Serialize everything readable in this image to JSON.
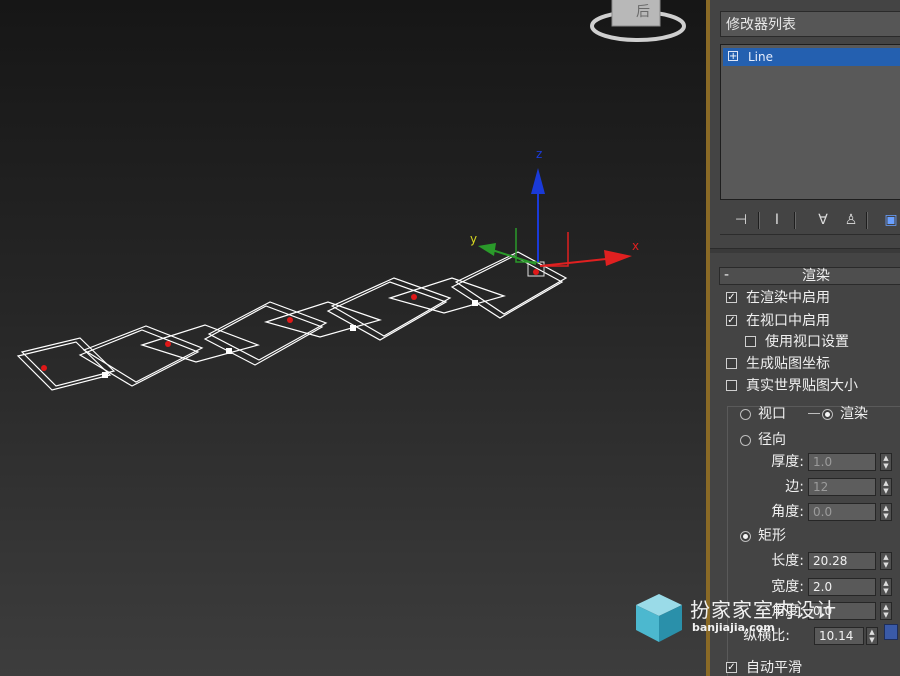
{
  "viewport": {
    "viewcube_face_label": "后",
    "axes": {
      "x_label": "x",
      "y_label": "y",
      "z_label": "z"
    }
  },
  "modifier_panel": {
    "modifier_list_label": "修改器列表",
    "stack_items": [
      {
        "label": "Line"
      }
    ],
    "toolbar_icons": [
      "pin-stack-icon",
      "show-end-result-icon",
      "make-unique-icon",
      "remove-modifier-icon",
      "configure-modifier-sets-icon"
    ]
  },
  "rendering_rollout": {
    "collapse_symbol": "-",
    "title": "渲染",
    "enable_in_renderer": {
      "label": "在渲染中启用",
      "checked": true
    },
    "enable_in_viewport": {
      "label": "在视口中启用",
      "checked": true
    },
    "use_viewport_settings": {
      "label": "使用视口设置",
      "checked": false
    },
    "generate_mapping_coords": {
      "label": "生成贴图坐标",
      "checked": false
    },
    "real_world_map_size": {
      "label": "真实世界贴图大小",
      "checked": false
    },
    "viewport_radio": {
      "label": "视口",
      "selected": false
    },
    "renderer_radio": {
      "label": "渲染",
      "selected": true
    },
    "radial": {
      "label": "径向",
      "selected": false,
      "thickness": {
        "label": "厚度:",
        "value": "1.0"
      },
      "sides": {
        "label": "边:",
        "value": "12"
      },
      "angle": {
        "label": "角度:",
        "value": "0.0"
      }
    },
    "rectangular": {
      "label": "矩形",
      "selected": true,
      "length": {
        "label": "长度:",
        "value": "20.28"
      },
      "width": {
        "label": "宽度:",
        "value": "2.0"
      },
      "angle": {
        "label": "角度:",
        "value": "0.0"
      },
      "aspect": {
        "label": "纵横比:",
        "value": "10.14"
      }
    },
    "auto_smooth": {
      "label": "自动平滑",
      "checked": true
    }
  },
  "watermark": {
    "title": "扮家家室内设计",
    "url": "banjiajia.com"
  },
  "colors": {
    "viewport_top": "#161616",
    "viewport_bottom": "#3d3d3d",
    "panel_bg": "#444444",
    "divider": "#8a6a26",
    "stack_selected": "#2460b0",
    "axis_x": "#e02020",
    "axis_y": "#2a9a2a",
    "axis_z": "#1a3ad8"
  }
}
